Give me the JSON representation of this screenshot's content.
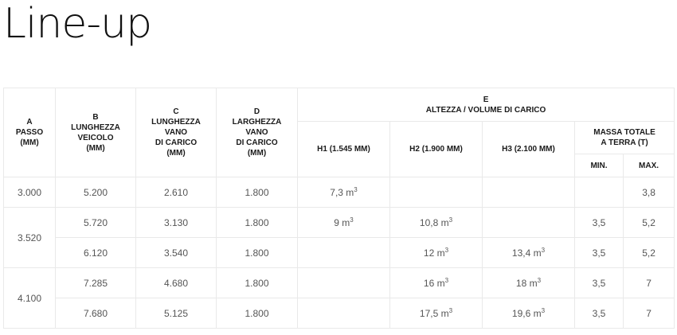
{
  "title": "Line-up",
  "headers": {
    "passo": "A\nPASSO\n(MM)",
    "lunghezza": "B\nLUNGHEZZA\nVEICOLO\n(MM)",
    "lunghezza_vano": "C\nLUNGHEZZA\nVANO\nDI CARICO\n(MM)",
    "larghezza_vano": "D\nLARGHEZZA\nVANO\nDI CARICO\n(MM)",
    "altezza_volume": "E\nALTEZZA / VOLUME DI CARICO",
    "h1": "H1 (1.545 MM)",
    "h2": "H2 (1.900 MM)",
    "h3": "H3 (2.100 MM)",
    "massa": "MASSA TOTALE\nA TERRA (T)",
    "min": "MIN.",
    "max": "MAX."
  },
  "volume_unit": "m",
  "volume_exp": "3",
  "rows": [
    {
      "passo": "3.000",
      "lunghezza": "5.200",
      "vano_l": "2.610",
      "vano_w": "1.800",
      "h1": "7,3",
      "h2": "",
      "h3": "",
      "min": "",
      "max": "3,8"
    },
    {
      "passo": "3.520",
      "lunghezza": "5.720",
      "vano_l": "3.130",
      "vano_w": "1.800",
      "h1": "9",
      "h2": "10,8",
      "h3": "",
      "min": "3,5",
      "max": "5,2"
    },
    {
      "passo": "",
      "lunghezza": "6.120",
      "vano_l": "3.540",
      "vano_w": "1.800",
      "h1": "",
      "h2": "12",
      "h3": "13,4",
      "min": "3,5",
      "max": "5,2"
    },
    {
      "passo": "4.100",
      "lunghezza": "7.285",
      "vano_l": "4.680",
      "vano_w": "1.800",
      "h1": "",
      "h2": "16",
      "h3": "18",
      "min": "3,5",
      "max": "7"
    },
    {
      "passo": "",
      "lunghezza": "7.680",
      "vano_l": "5.125",
      "vano_w": "1.800",
      "h1": "",
      "h2": "17,5",
      "h3": "19,6",
      "min": "3,5",
      "max": "7"
    }
  ]
}
